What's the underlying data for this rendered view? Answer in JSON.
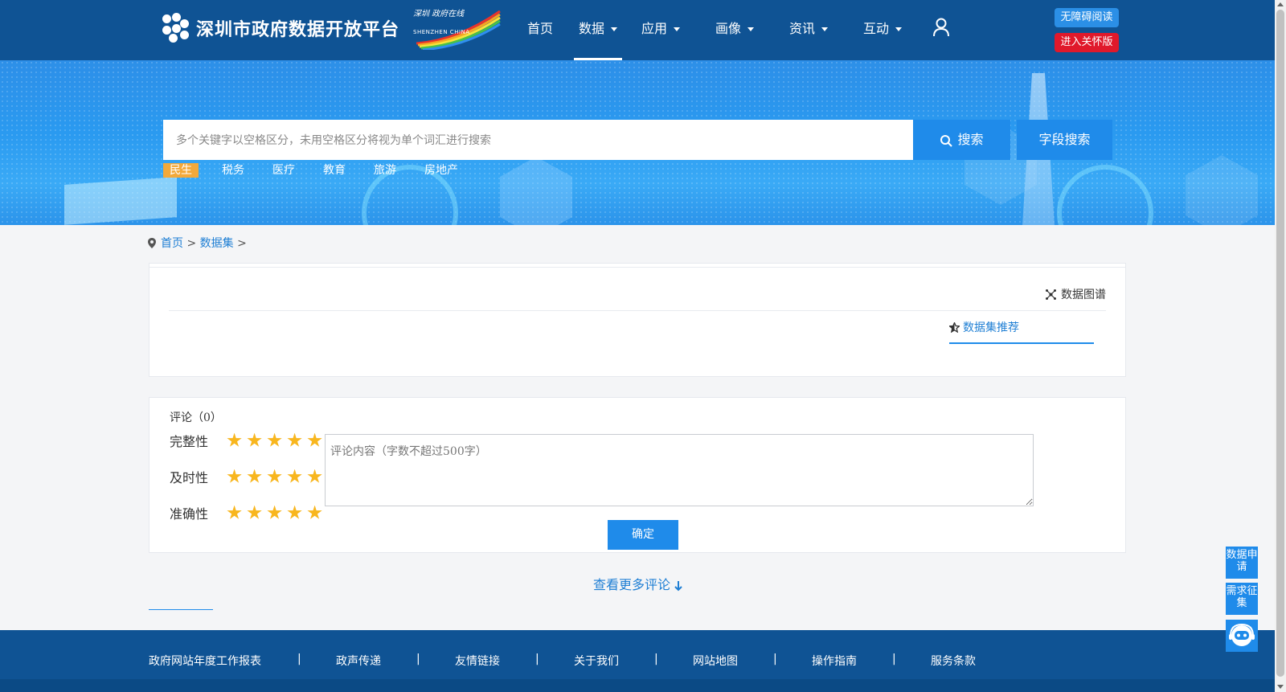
{
  "header": {
    "site_title": "深圳市政府数据开放平台",
    "badge_text": "深圳 政府在线",
    "badge_sub": "SHENZHEN CHINA",
    "nav": [
      {
        "label": "首页",
        "dropdown": false,
        "active": false
      },
      {
        "label": "数据",
        "dropdown": true,
        "active": true
      },
      {
        "label": "应用",
        "dropdown": true,
        "active": false
      },
      {
        "label": "画像",
        "dropdown": true,
        "active": false
      },
      {
        "label": "资讯",
        "dropdown": true,
        "active": false
      },
      {
        "label": "互动",
        "dropdown": true,
        "active": false
      }
    ],
    "user_icon": "user-icon",
    "accessible_label": "无障碍阅读",
    "care_label": "进入关怀版"
  },
  "search": {
    "placeholder": "多个关键字以空格区分，未用空格区分将视为单个词汇进行搜索",
    "search_label": "搜索",
    "field_search_label": "字段搜索",
    "tags": [
      "民生",
      "税务",
      "医疗",
      "教育",
      "旅游",
      "房地产"
    ],
    "active_tag": "民生"
  },
  "breadcrumb": {
    "items": [
      "首页",
      "数据集"
    ],
    "separator": ">"
  },
  "dataset_panel": {
    "graph_link": "数据图谱",
    "recommend_tab": "数据集推荐"
  },
  "comments": {
    "title": "评论（0）",
    "ratings": [
      {
        "label": "完整性",
        "stars": 5
      },
      {
        "label": "及时性",
        "stars": 5
      },
      {
        "label": "准确性",
        "stars": 5
      }
    ],
    "placeholder": "评论内容（字数不超过500字）",
    "submit_label": "确定",
    "more_label": "查看更多评论"
  },
  "footer": {
    "links": [
      "政府网站年度工作报表",
      "政声传递",
      "友情链接",
      "关于我们",
      "网站地图",
      "操作指南",
      "服务条款"
    ],
    "separator": "|"
  },
  "floating": {
    "data_apply": "数据申请",
    "demand": "需求征集",
    "robot_icon": "robot-icon"
  },
  "colors": {
    "header_bg": "#0f5394",
    "primary": "#1f8bea",
    "active_tag": "#f2a93b",
    "care_red": "#e0192b",
    "star": "#f8b61e"
  }
}
